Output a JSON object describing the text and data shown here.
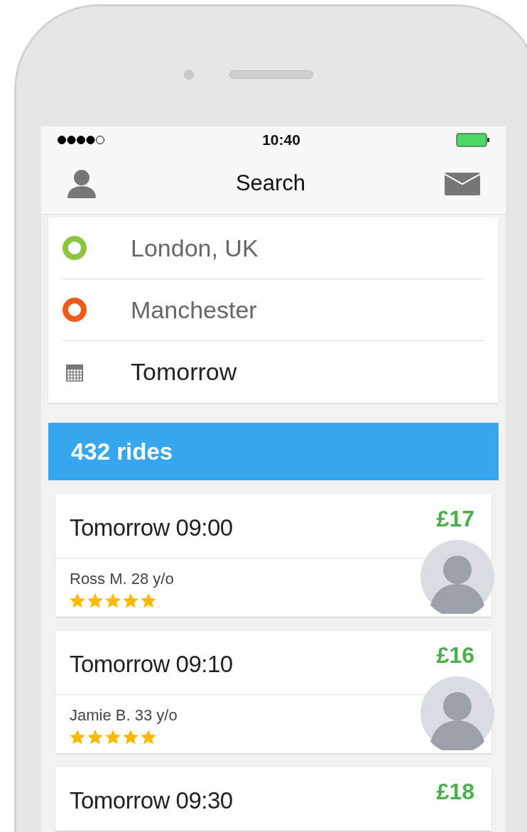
{
  "status_bar": {
    "time": "10:40"
  },
  "nav_bar": {
    "title": "Search"
  },
  "search_fields": [
    {
      "kind": "origin",
      "value": "London, UK"
    },
    {
      "kind": "destination",
      "value": "Manchester"
    },
    {
      "kind": "date",
      "value": "Tomorrow"
    }
  ],
  "results_header": "432 rides",
  "rides": [
    {
      "time": "Tomorrow 09:00",
      "price": "£17",
      "driver": "Ross M. 28 y/o",
      "stars": 5
    },
    {
      "time": "Tomorrow 09:10",
      "price": "£16",
      "driver": "Jamie B. 33 y/o",
      "stars": 5
    },
    {
      "time": "Tomorrow 09:30",
      "price": "£18"
    }
  ]
}
